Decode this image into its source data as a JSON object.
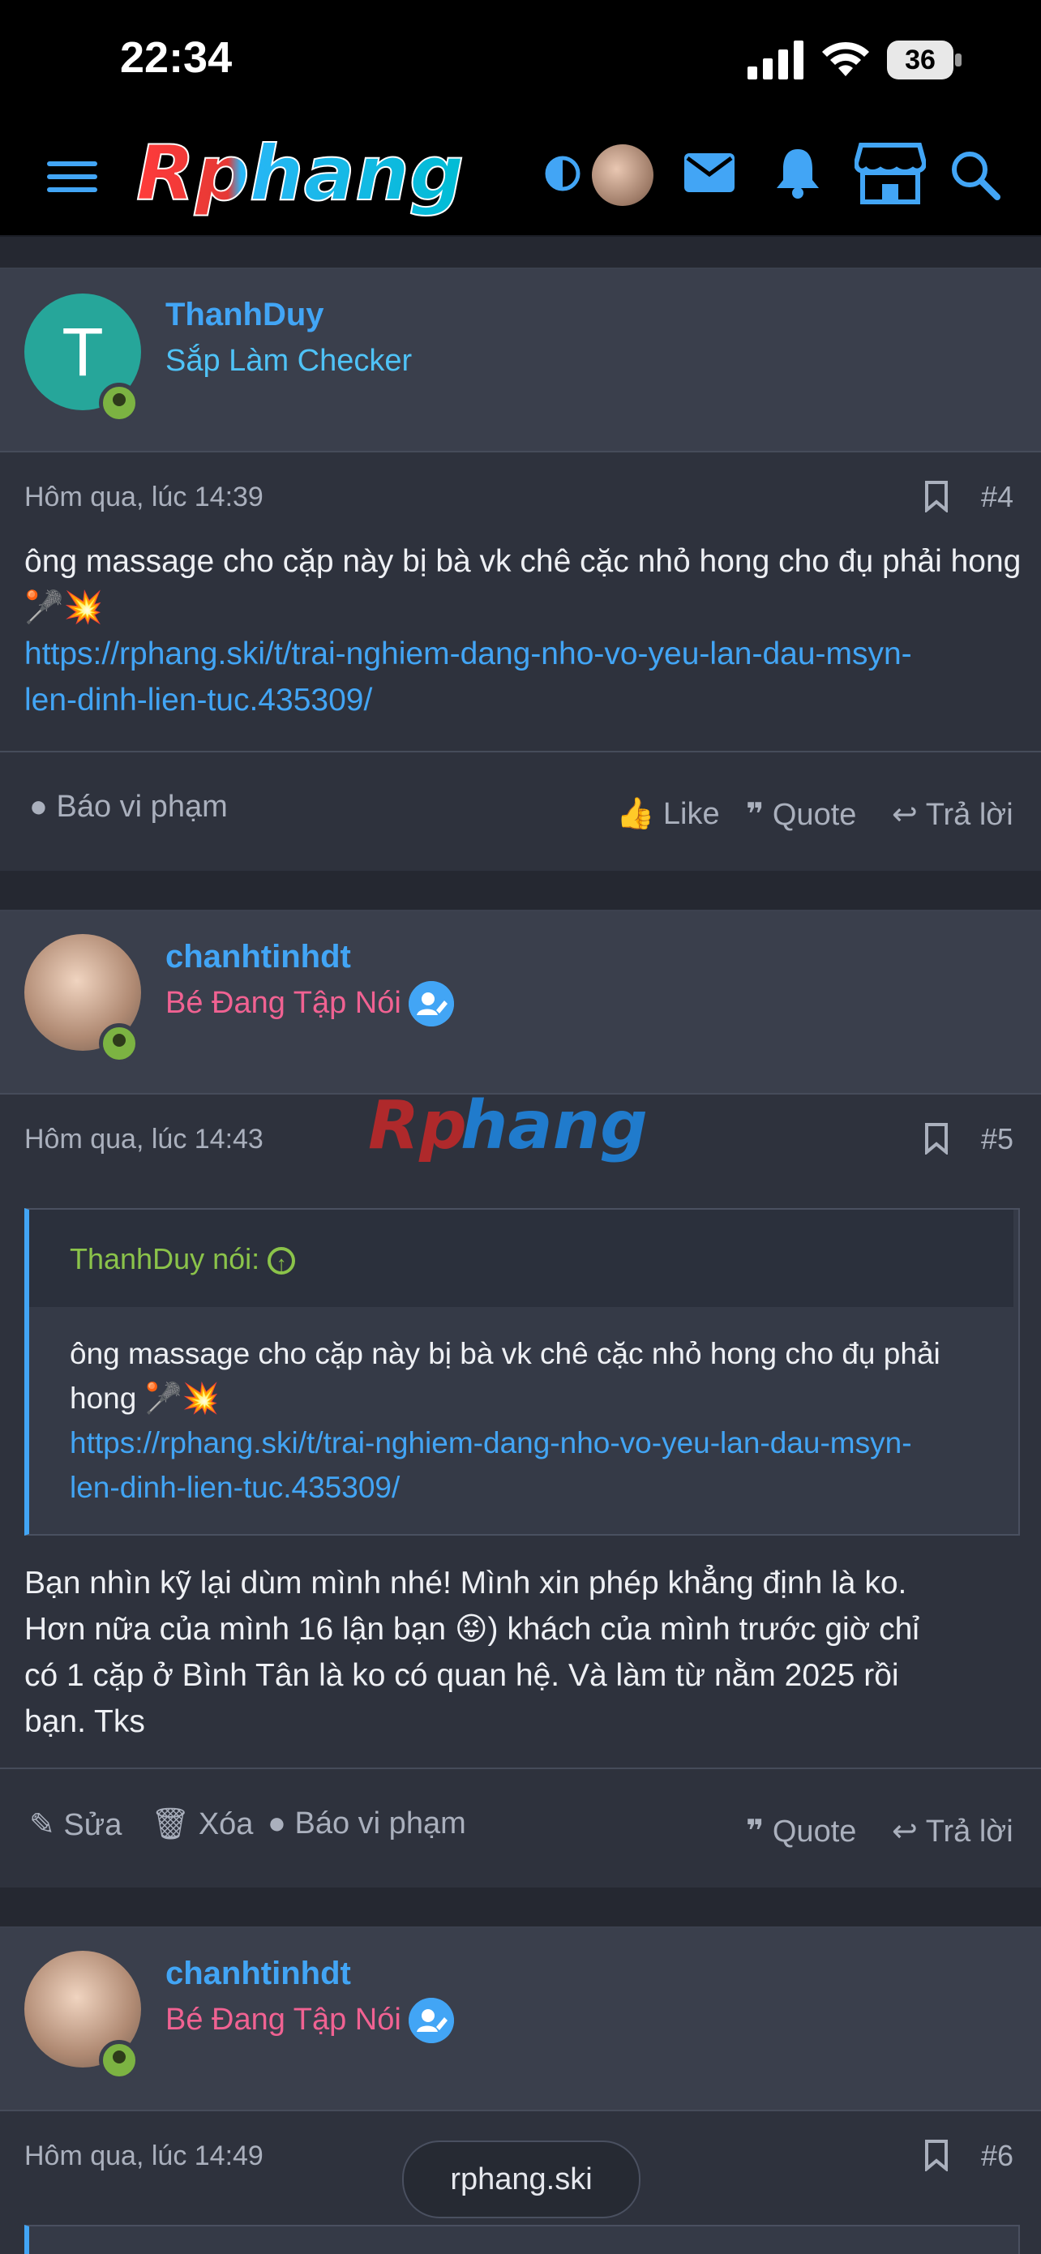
{
  "status_bar": {
    "time": "22:34",
    "battery": "36"
  },
  "header": {
    "logo_text": "Rphang",
    "icons": [
      "menu-icon",
      "contrast-icon",
      "avatar",
      "mail-icon",
      "bell-icon",
      "store-icon",
      "search-icon"
    ]
  },
  "posts": [
    {
      "username": "ThanhDuy",
      "user_title": "Sắp Làm Checker",
      "avatar_letter": "T",
      "timestamp": "Hôm qua, lúc 14:39",
      "post_number": "#4",
      "body_text": "ông massage cho cặp này bị bà vk chê cặc nhỏ hong cho đụ phải hong",
      "link_line1": "https://rphang.ski/t/trai-nghiem-dang-nho-vo-yeu-lan-dau-msyn-",
      "link_line2": "len-dinh-lien-tuc.435309/",
      "actions": {
        "report": "Báo vi phạm",
        "like": "Like",
        "quote": "Quote",
        "reply": "Trả lời"
      }
    },
    {
      "username": "chanhtinhdt",
      "user_title": "Bé Đang Tập Nói",
      "timestamp": "Hôm qua, lúc 14:43",
      "post_number": "#5",
      "quote": {
        "author": "ThanhDuy nói:",
        "text": "ông massage cho cặp này bị bà vk chê cặc nhỏ hong cho đụ phải hong",
        "link_line1": "https://rphang.ski/t/trai-nghiem-dang-nho-vo-yeu-lan-dau-msyn-",
        "link_line2": "len-dinh-lien-tuc.435309/"
      },
      "body_lines": [
        "Bạn nhìn kỹ lại dùm mình nhé! Mình xin phép khẳng định là ko.",
        "Hơn nữa của mình 16 lận bạn 😝) khách của mình trước giờ chỉ",
        "có 1 cặp ở Bình Tân là ko có quan hệ. Và làm từ nằm 2025 rồi",
        "bạn. Tks"
      ],
      "actions": {
        "edit": "Sửa",
        "delete": "Xóa",
        "report": "Báo vi phạm",
        "quote": "Quote",
        "reply": "Trả lời"
      }
    },
    {
      "username": "chanhtinhdt",
      "user_title": "Bé Đang Tập Nói",
      "timestamp": "Hôm qua, lúc 14:49",
      "post_number": "#6"
    }
  ],
  "watermark": "Rphang",
  "domain_pill": "rphang.ski",
  "colors": {
    "accent": "#42a5f5",
    "user_title_1": "#4fc3f7",
    "user_title_2": "#f06292",
    "online": "#7cb342",
    "quote_author": "#8bc34a"
  }
}
